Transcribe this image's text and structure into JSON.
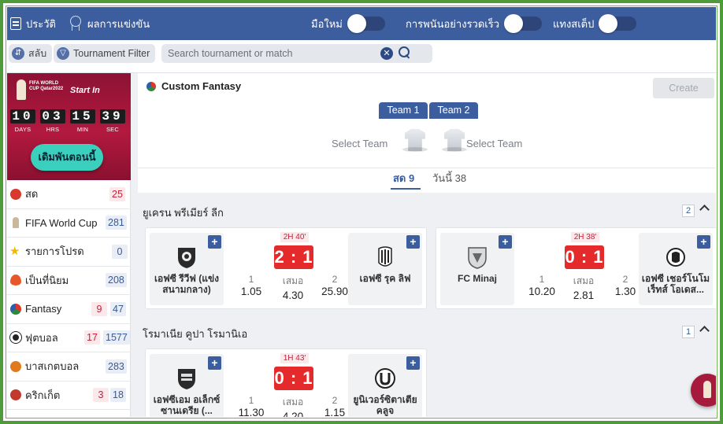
{
  "topbar": {
    "history_label": "ประวัติ",
    "results_label": "ผลการแข่งขัน",
    "toggles": [
      {
        "label": "มือใหม่",
        "on": false
      },
      {
        "label": "การพนันอย่างรวดเร็ว",
        "on": false
      },
      {
        "label": "แทงสเต็ป",
        "on": false
      }
    ]
  },
  "filterbar": {
    "switch_label": "สลับ",
    "tournament_filter_label": "Tournament Filter",
    "search_placeholder": "Search tournament or match"
  },
  "sidebar": {
    "banner": {
      "logo_text": "FIFA WORLD CUP Qatar2022",
      "start_in": "Start In",
      "countdown": [
        {
          "value": "10",
          "label": "DAYS"
        },
        {
          "value": "03",
          "label": "HRS"
        },
        {
          "value": "15",
          "label": "MIN"
        },
        {
          "value": "39",
          "label": "SEC"
        }
      ],
      "cta": "เดิมพันตอนนี้"
    },
    "items": [
      {
        "label": "สด",
        "icon": "live-icon",
        "live": "25",
        "count": ""
      },
      {
        "label": "FIFA World Cup",
        "icon": "trophy-icon",
        "live": "",
        "count": "281"
      },
      {
        "label": "รายการโปรด",
        "icon": "star-icon",
        "live": "",
        "count": "0"
      },
      {
        "label": "เป็นที่นิยม",
        "icon": "fire-icon",
        "live": "",
        "count": "208"
      },
      {
        "label": "Fantasy",
        "icon": "fantasy-ball-icon",
        "live": "9",
        "count": "47"
      },
      {
        "label": "ฟุตบอล",
        "icon": "soccer-ball-icon",
        "live": "17",
        "count": "1577"
      },
      {
        "label": "บาสเกตบอล",
        "icon": "basketball-icon",
        "live": "",
        "count": "283"
      },
      {
        "label": "คริกเก็ต",
        "icon": "cricket-ball-icon",
        "live": "3",
        "count": "18"
      }
    ]
  },
  "fantasy": {
    "title": "Custom Fantasy",
    "create_label": "Create",
    "team1_tab": "Team 1",
    "team2_tab": "Team 2",
    "select_team": "Select Team",
    "live_tab": "สด 9",
    "today_tab": "วันนี้ 38"
  },
  "leagues": [
    {
      "name": "ยูเครน พรีเมียร์ ลีก",
      "count": "2",
      "matches": [
        {
          "home": "เอฟซี รีวีฟ (แข่งสนามกลาง)",
          "away": "เอฟซี รุค ลิฟ",
          "time": "2H 40'",
          "score": "2 : 1",
          "odds": [
            {
              "label": "1",
              "value": "1.05"
            },
            {
              "label": "เสมอ",
              "value": "4.30"
            },
            {
              "label": "2",
              "value": "25.90"
            }
          ]
        },
        {
          "home": "FC Minaj",
          "away": "เอฟซี เชอร์โนโมเร็ทส์ โอเดส...",
          "time": "2H 38'",
          "score": "0 : 1",
          "odds": [
            {
              "label": "1",
              "value": "10.20"
            },
            {
              "label": "เสมอ",
              "value": "2.81"
            },
            {
              "label": "2",
              "value": "1.30"
            }
          ]
        }
      ]
    },
    {
      "name": "โรมาเนีย คูปา โรมานิเอ",
      "count": "1",
      "matches": [
        {
          "home": "เอฟซีเอม อเล็กซ์ซานเดรีย (...",
          "away": "ยูนิเวอร์ซิตาเตีย คลูจ",
          "time": "1H 43'",
          "score": "0 : 1",
          "odds": [
            {
              "label": "1",
              "value": "11.30"
            },
            {
              "label": "เสมอ",
              "value": "4.20"
            },
            {
              "label": "2",
              "value": "1.15"
            }
          ]
        }
      ]
    }
  ]
}
